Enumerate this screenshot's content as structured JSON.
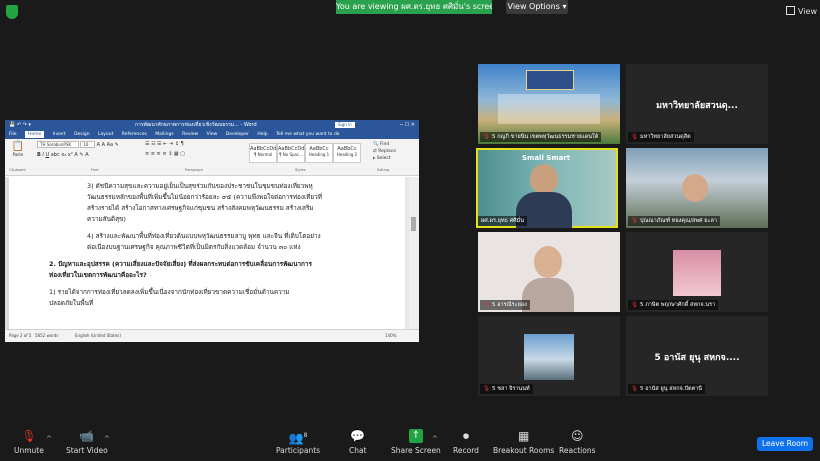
{
  "top": {
    "banner": "You are viewing ผศ.ดร.ยุทธ ศศิมั่น's screen",
    "view_options": "View Options",
    "view_button": "View"
  },
  "word": {
    "title": "การพัฒนาศักยภาพการท่องเที่ยวเชิงวัฒนธรรม... - Word",
    "signin": "Sign in",
    "tabs": [
      "File",
      "Home",
      "Insert",
      "Design",
      "Layout",
      "References",
      "Mailings",
      "Review",
      "View",
      "Developer",
      "Help",
      "Tell me what you want to do"
    ],
    "ribbon": {
      "font_name": "TH SarabunPSK",
      "font_size": "16",
      "paste": "Paste",
      "styles": [
        {
          "preview": "AaBbCcDd",
          "label": "¶ Normal"
        },
        {
          "preview": "AaBbCcDd",
          "label": "¶ No Spac..."
        },
        {
          "preview": "AaBbCc",
          "label": "Heading 1"
        },
        {
          "preview": "AaBbCc",
          "label": "Heading 2"
        }
      ],
      "find": "Find",
      "replace": "Replace",
      "select": "Select",
      "groups": [
        "Clipboard",
        "Font",
        "Paragraph",
        "Styles",
        "Editing"
      ]
    },
    "lines": [
      "3)  ดัชนีความสุขและความอยู่เย็นเป็นสุขร่วมกันของประชาชนในชุมชนท่องเที่ยวพหุ",
      "     วัฒนธรรมหลักของพื้นที่เพิ่มขึ้นไม่น้อยกว่าร้อยละ ๙๕ (ความพึงพอใจต่อการท่องเที่ยวที่",
      "     สร้างรายได้ สร้างโอกาสทางเศรษฐกิจแก่ชุมชน สร้างสังคมพหุวัฒนธรรม สร้างเสริม",
      "     ความสันติสุข)",
      "4)  สร้างและพัฒนาพื้นที่ท่องเที่ยวต้นแบบพหุวัฒนธรรมลาบู พุทธ และจีน ที่เติบโตอย่าง",
      "     ต่อเนื่องบนฐานเศรษฐกิจ คุณภาพชีวิตที่เป็นมิตรกับสิ่งแวดล้อม จำนวน ๓๐ แห่ง",
      "2.  ปัญหาและอุปสรรค (ความเสี่ยงและปัจจัยเสี่ยง) ที่ส่งผลกระทบต่อการขับเคลื่อนการพัฒนาการ",
      "     ท่องเที่ยวในเขตการพัฒนาคืออะไร?",
      "          1) รายได้จากการท่องเที่ยวลดลงเพิ่มขึ้นเนื่องจากนักท่องเที่ยวขาดความเชื่อมั่นด้านความ",
      "     ปลอดภัยในพื้นที่"
    ],
    "status": {
      "page": "Page 2 of 5",
      "words": "5852 words",
      "lang": "English (United States)",
      "zoom": "140%"
    }
  },
  "tiles": [
    {
      "name": "5 กญภิ ขายนิน เขตพหุวัฒนธรรมชายแดนใต้",
      "mic_muted": true
    },
    {
      "name": "มหาวิทยาลัยสวนดุสิต",
      "big": "มหาวิทยาลัยสวนดุ...",
      "mic_muted": true
    },
    {
      "name": "ผศ.ดร.ยุทธ ศศิมั่น",
      "mic_muted": false,
      "overlay": "Small Smart"
    },
    {
      "name": "ปุณณาภัณฑ์ ทองคุณ/สพศ ยะลา",
      "mic_muted": true
    },
    {
      "name": "5 อารณีระยอง",
      "mic_muted": true
    },
    {
      "name": "5 ภาษิต พฤกษาศักดิ์ สหกจ.นรา",
      "mic_muted": true
    },
    {
      "name": "5 ชลา  จิรานนท์",
      "mic_muted": true
    },
    {
      "name": "5 อานัส ยูนุ สหกจ.ปัตตานี",
      "big": "5 อานัส ยุนุ สหกจ....",
      "mic_muted": true
    }
  ],
  "toolbar": {
    "unmute": "Unmute",
    "start_video": "Start Video",
    "participants": "Participants",
    "participants_count": "8",
    "chat": "Chat",
    "share": "Share Screen",
    "record": "Record",
    "breakout": "Breakout Rooms",
    "reactions": "Reactions",
    "leave": "Leave Room"
  },
  "colors": {
    "zoom_green": "#23a443",
    "word_blue": "#2b579a",
    "leave_blue": "#0e72ed",
    "active_outline": "#e5e01b",
    "mute_red": "#e0312f"
  }
}
